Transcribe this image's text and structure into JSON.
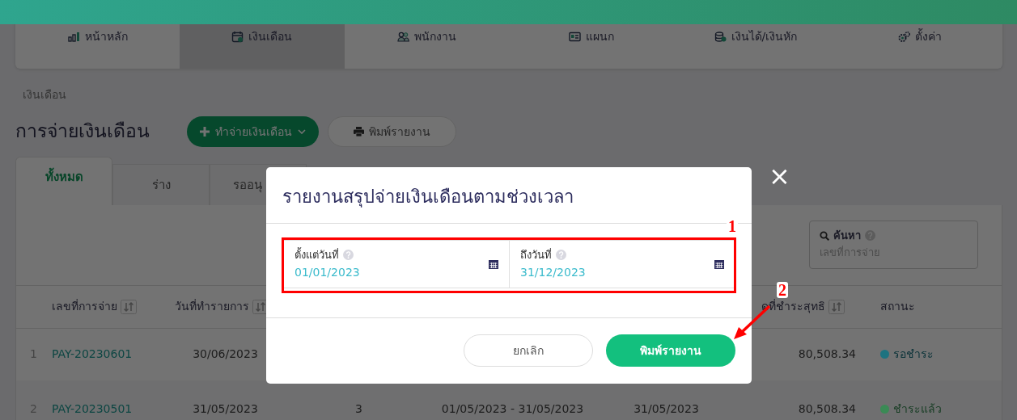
{
  "nav": [
    {
      "label": "หน้าหลัก",
      "selected": false
    },
    {
      "label": "เงินเดือน",
      "selected": true
    },
    {
      "label": "พนักงาน",
      "selected": false
    },
    {
      "label": "แผนก",
      "selected": false
    },
    {
      "label": "เงินได้/เงินหัก",
      "selected": false
    },
    {
      "label": "ตั้งค่า",
      "selected": false
    }
  ],
  "breadcrumb": "เงินเดือน",
  "page_title": "การจ่ายเงินเดือน",
  "actions": [
    {
      "kind": "primary",
      "label": "ทำจ่ายเงินเดือน"
    },
    {
      "kind": "outline",
      "label": "พิมพ์รายงาน"
    }
  ],
  "tabs": [
    {
      "label": "ทั้งหมด",
      "selected": true
    },
    {
      "label": "ร่าง",
      "selected": false
    },
    {
      "label": "รออนุ",
      "selected": false
    }
  ],
  "search": {
    "label": "ค้นหา",
    "placeholder": "เลขที่การจ่าย"
  },
  "table": {
    "columns": [
      {
        "label": "เลขที่การจ่าย",
        "sortable": true
      },
      {
        "label": "วันที่ทำรายการ",
        "sortable": true
      },
      {
        "label": "ดที่ชำระสุทธิ",
        "sortable": true
      },
      {
        "label": "สถานะ",
        "sortable": false
      }
    ],
    "rows": [
      {
        "index": "1",
        "number": "PAY-20230601",
        "date": "30/06/2023",
        "amount": "80,508.34",
        "status": {
          "label": "รอชำระ",
          "color": "#1e7380"
        }
      },
      {
        "index": "2",
        "number": "PAY-20230501",
        "date": "31/05/2023",
        "count": "3",
        "period": "01/05/2023 - 31/05/2023",
        "pay_date": "31/05/2023",
        "amount": "80,508.34",
        "status": {
          "label": "ชำระแล้ว",
          "color": "#3a8a55"
        }
      }
    ]
  },
  "modal": {
    "title": "รายงานสรุปจ่ายเงินเดือนตามช่วงเวลา",
    "fields": [
      {
        "label": "ตั้งแต่วันที่",
        "value": "01/01/2023"
      },
      {
        "label": "ถึงวันที่",
        "value": "31/12/2023"
      }
    ],
    "buttons": [
      {
        "kind": "cancel",
        "label": "ยกเลิก"
      },
      {
        "kind": "confirm",
        "label": "พิมพ์รายงาน"
      }
    ],
    "close": "×"
  },
  "annotations": [
    {
      "kind": "box",
      "label": "1"
    },
    {
      "kind": "arrow",
      "label": "2"
    }
  ]
}
